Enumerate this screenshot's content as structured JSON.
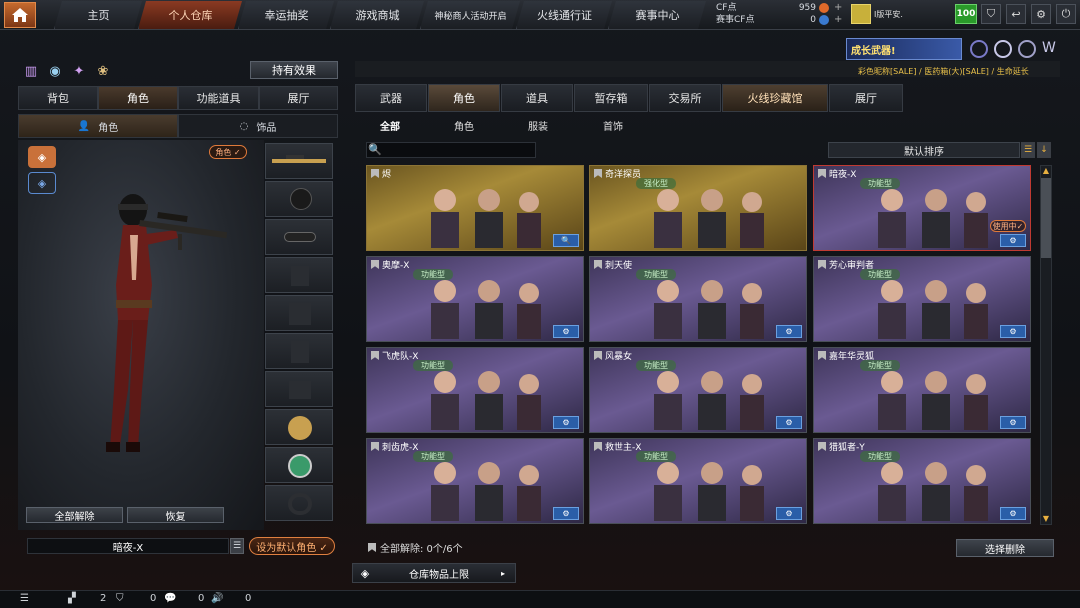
{
  "nav": {
    "tabs": [
      "主页",
      "个人仓库",
      "幸运抽奖",
      "游戏商城",
      "神秘商人活动开启",
      "火线通行证",
      "赛事中心"
    ],
    "active_index": 1
  },
  "currency": {
    "cf_label": "CF点",
    "cf_value": "959",
    "event_label": "赛事CF点",
    "event_value": "0"
  },
  "user": {
    "name": "I版平安.",
    "level": "100"
  },
  "left": {
    "effect_button": "持有效果",
    "tabs": [
      "背包",
      "角色",
      "功能道具",
      "展厅"
    ],
    "subtabs": [
      "角色",
      "饰品"
    ],
    "role_badge": "角色 ✓",
    "release_all": "全部解除",
    "restore": "恢复",
    "character_name": "暗夜-X",
    "set_default": "设为默认角色 ✓"
  },
  "promo": {
    "banner": "成长武器!",
    "scroll_text": "彩色昵称[SALE] / 医药箱(大)[SALE] / 生命延长"
  },
  "right": {
    "tabs": [
      "武器",
      "角色",
      "道具",
      "暂存箱",
      "交易所",
      "火线珍藏馆",
      "展厅"
    ],
    "active_tab": 1,
    "subtabs": [
      "全部",
      "角色",
      "服装",
      "首饰"
    ],
    "sort_label": "默认排序",
    "cards": [
      {
        "name": "烬",
        "tag": "",
        "style": "gold",
        "inuse": "",
        "btn": "🔍"
      },
      {
        "name": "奇洋探员",
        "tag": "强化型",
        "style": "gold",
        "inuse": "",
        "btn": ""
      },
      {
        "name": "暗夜-X",
        "tag": "功能型",
        "style": "purple",
        "inuse": "使用中✓",
        "btn": "⚙"
      },
      {
        "name": "奥摩-X",
        "tag": "功能型",
        "style": "purple",
        "inuse": "",
        "btn": "⚙"
      },
      {
        "name": "刺天使",
        "tag": "功能型",
        "style": "purple",
        "inuse": "",
        "btn": "⚙"
      },
      {
        "name": "芳心审判者",
        "tag": "功能型",
        "style": "purple",
        "inuse": "",
        "btn": "⚙"
      },
      {
        "name": "飞虎队-X",
        "tag": "功能型",
        "style": "purple",
        "inuse": "",
        "btn": "⚙"
      },
      {
        "name": "风暴女",
        "tag": "功能型",
        "style": "purple",
        "inuse": "",
        "btn": "⚙"
      },
      {
        "name": "嘉年华灵狐",
        "tag": "功能型",
        "style": "purple",
        "inuse": "",
        "btn": "⚙"
      },
      {
        "name": "刺齿虎-X",
        "tag": "功能型",
        "style": "purple",
        "inuse": "",
        "btn": "⚙"
      },
      {
        "name": "救世主-X",
        "tag": "功能型",
        "style": "purple",
        "inuse": "",
        "btn": "⚙"
      },
      {
        "name": "猎狐者-Y",
        "tag": "功能型",
        "style": "purple",
        "inuse": "",
        "btn": "⚙"
      }
    ],
    "remove_info": "全部解除: 0个/6个",
    "select_remove": "选择删除",
    "capacity": "仓库物品上限"
  },
  "bottom": {
    "friends": "2",
    "messages": "0",
    "chat": "0",
    "voice": "0"
  },
  "colors": {
    "accent": "#e07a3a",
    "gold_card": "#a68a38",
    "purple_card": "#6a5a92"
  }
}
